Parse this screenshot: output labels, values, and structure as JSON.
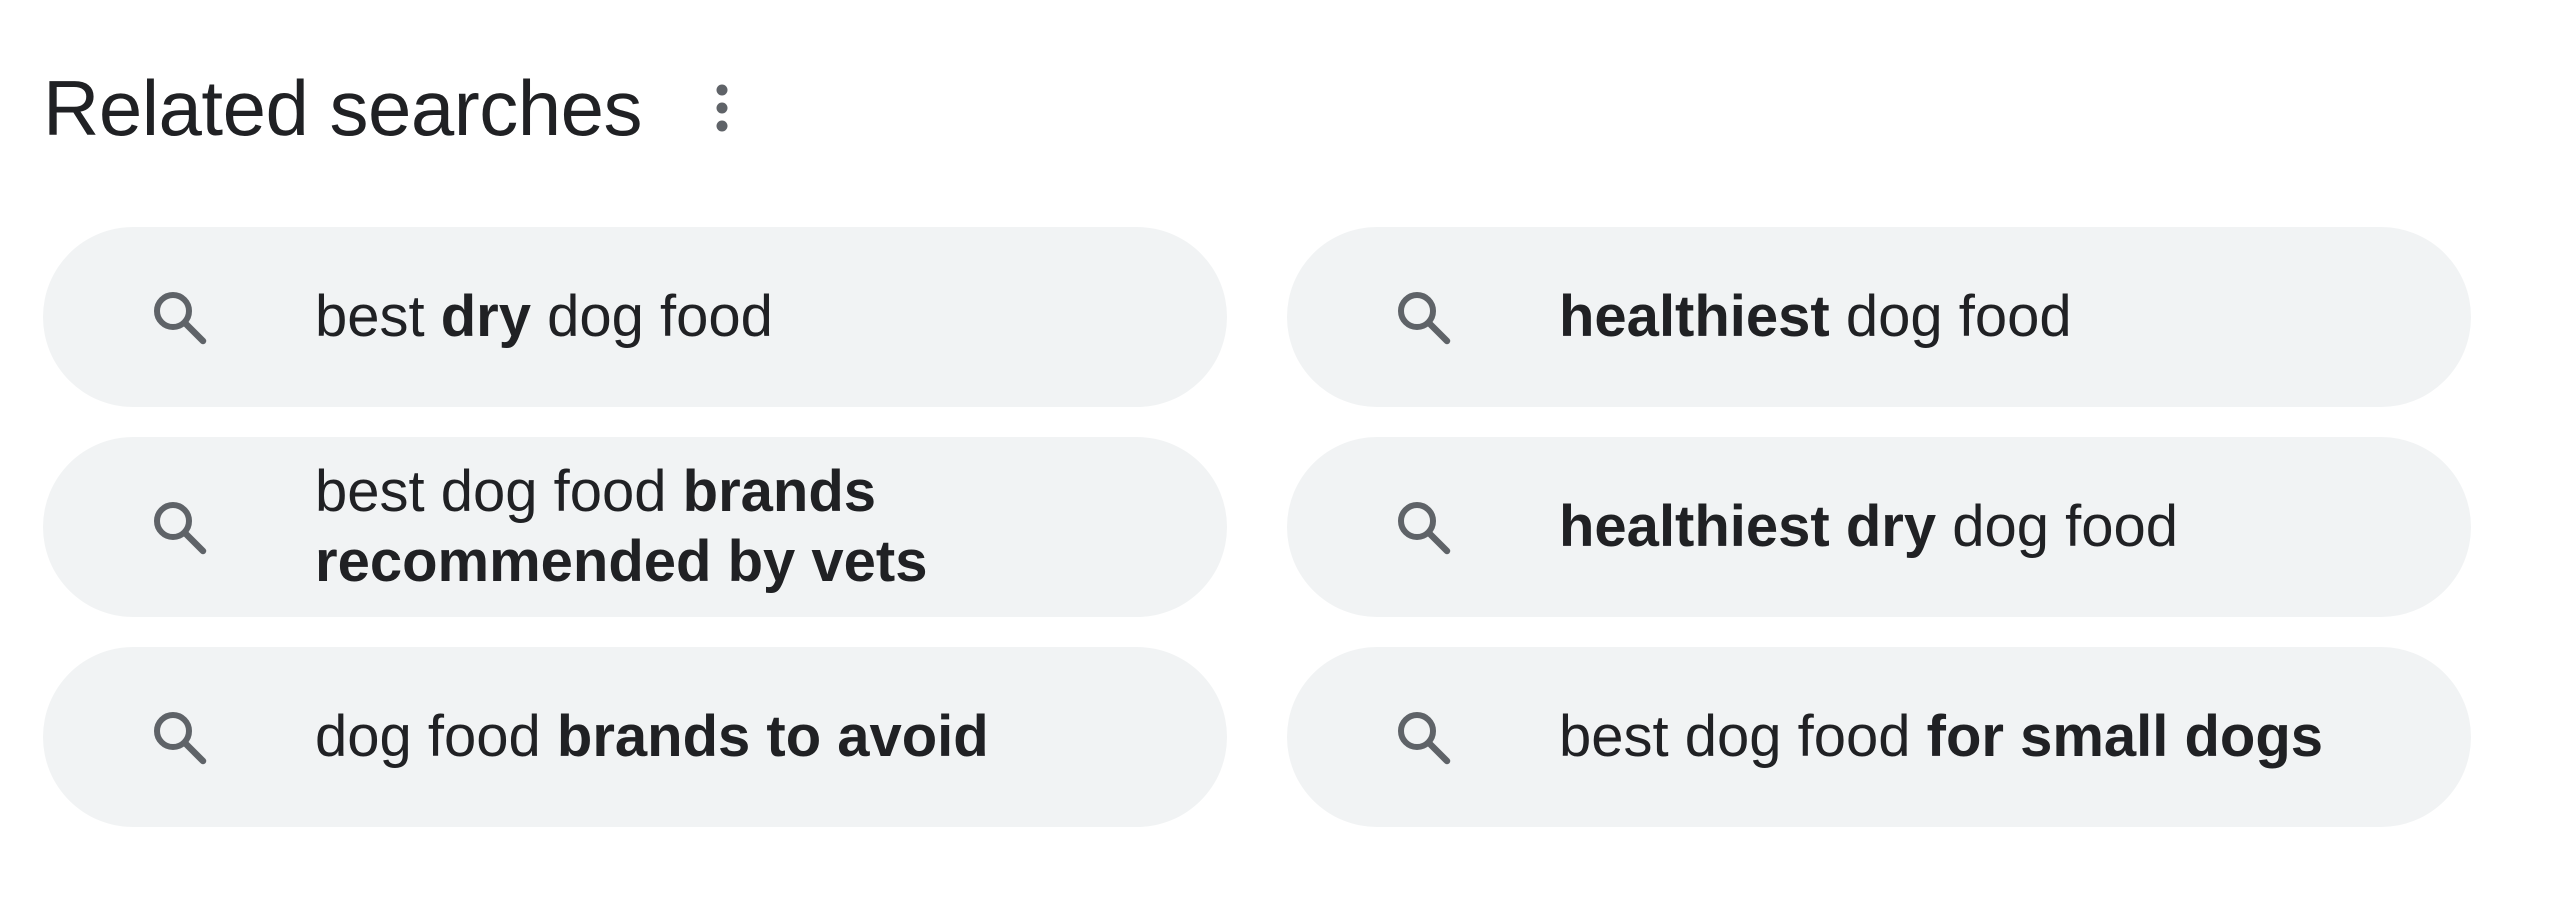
{
  "header": {
    "title": "Related searches",
    "more_icon": "vertical-dots-icon"
  },
  "searches": [
    {
      "icon": "search-icon",
      "parts": [
        {
          "text": "best ",
          "bold": false
        },
        {
          "text": "dry",
          "bold": true
        },
        {
          "text": " dog food",
          "bold": false
        }
      ]
    },
    {
      "icon": "search-icon",
      "parts": [
        {
          "text": "healthiest",
          "bold": true
        },
        {
          "text": " dog food",
          "bold": false
        }
      ]
    },
    {
      "icon": "search-icon",
      "parts": [
        {
          "text": "best dog food ",
          "bold": false
        },
        {
          "text": "brands recommended by vets",
          "bold": true
        }
      ]
    },
    {
      "icon": "search-icon",
      "parts": [
        {
          "text": "healthiest dry",
          "bold": true
        },
        {
          "text": " dog food",
          "bold": false
        }
      ]
    },
    {
      "icon": "search-icon",
      "parts": [
        {
          "text": "dog food ",
          "bold": false
        },
        {
          "text": "brands to avoid",
          "bold": true
        }
      ]
    },
    {
      "icon": "search-icon",
      "parts": [
        {
          "text": "best dog food ",
          "bold": false
        },
        {
          "text": "for small dogs",
          "bold": true
        }
      ]
    }
  ],
  "colors": {
    "chip_background": "#f1f3f4",
    "text": "#202124",
    "icon": "#5f6368"
  }
}
